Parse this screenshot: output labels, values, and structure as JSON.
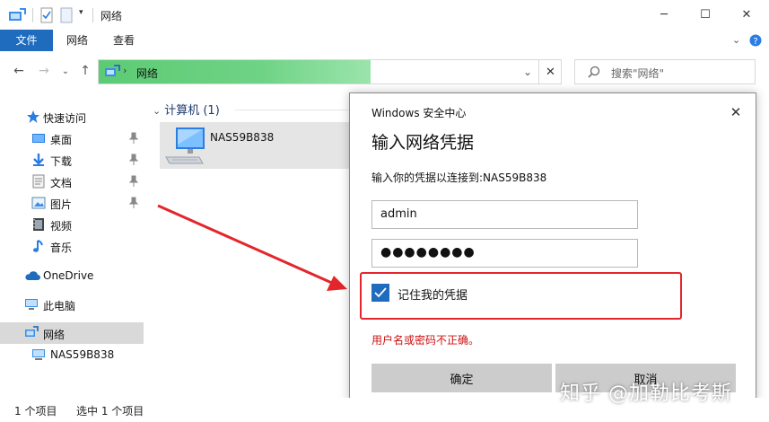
{
  "window": {
    "title": "网络"
  },
  "ribbon": {
    "file_tab": "文件",
    "network_tab": "网络",
    "view_tab": "查看"
  },
  "address": {
    "location": "网络"
  },
  "search": {
    "placeholder": "搜索\"网络\""
  },
  "nav": {
    "quick_access": "快速访问",
    "items": [
      {
        "label": "桌面"
      },
      {
        "label": "下载"
      },
      {
        "label": "文档"
      },
      {
        "label": "图片"
      },
      {
        "label": "视频"
      },
      {
        "label": "音乐"
      }
    ],
    "onedrive": "OneDrive",
    "this_pc": "此电脑",
    "network": "网络",
    "nas": "NAS59B838"
  },
  "content": {
    "group_header": "计算机 (1)",
    "item_name": "NAS59B838"
  },
  "dialog": {
    "title": "Windows 安全中心",
    "heading": "输入网络凭据",
    "description": "输入你的凭据以连接到:NAS59B838",
    "username": "admin",
    "password": "●●●●●●●●",
    "remember_label": "记住我的凭据",
    "error": "用户名或密码不正确。",
    "ok_label": "确定",
    "cancel_label": "取消"
  },
  "status": {
    "count": "1 个项目",
    "selected": "选中 1 个项目"
  },
  "watermark": "知乎 @加勒比考斯",
  "colors": {
    "accent": "#1f6cbf",
    "address_fill": "#5ccb74",
    "error": "#cc1010",
    "highlight_box": "#e3262b"
  }
}
